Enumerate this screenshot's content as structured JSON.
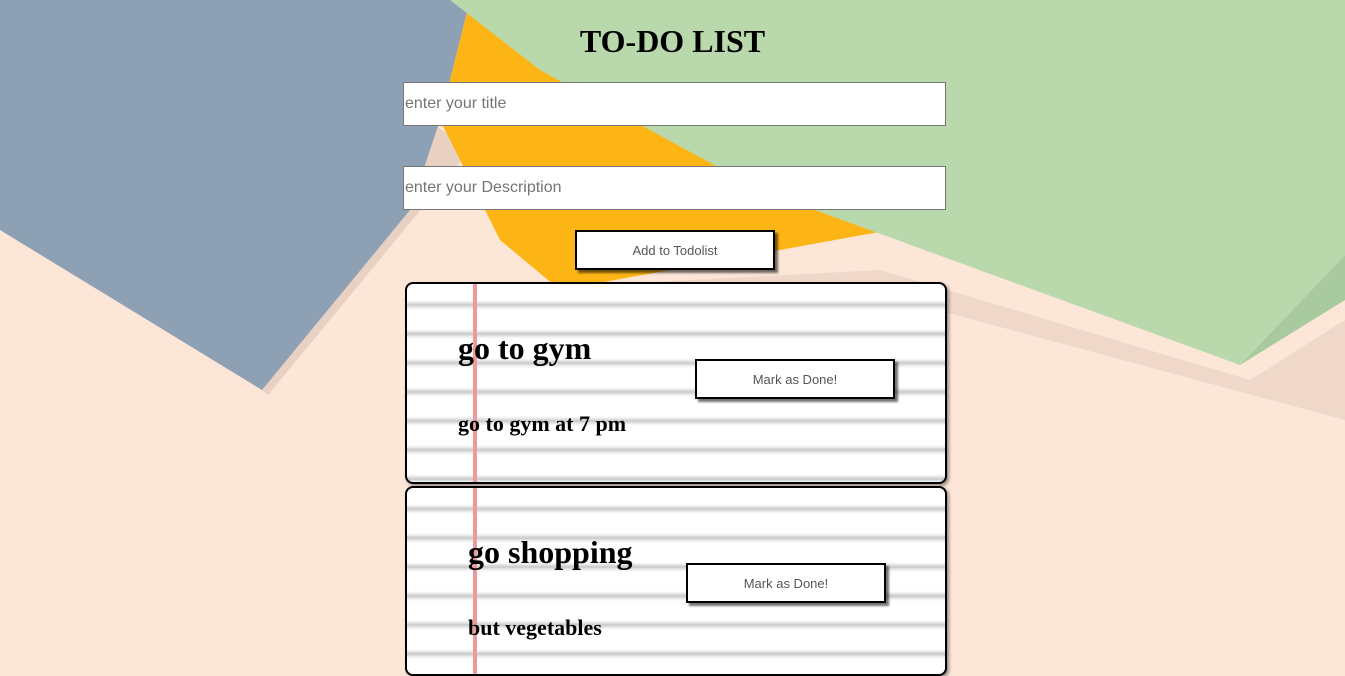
{
  "header": {
    "title": "TO-DO LIST"
  },
  "form": {
    "title_placeholder": "enter your title",
    "title_value": "",
    "description_placeholder": "enter your Description",
    "description_value": "",
    "add_button_label": "Add to Todolist"
  },
  "todos": [
    {
      "title": "go to gym",
      "description": "go to gym at 7 pm",
      "done_label": "Mark as Done!"
    },
    {
      "title": "go shopping",
      "description": "but vegetables",
      "done_label": "Mark as Done!"
    }
  ],
  "colors": {
    "background": "#fbe6d8",
    "paper_blue": "#8ea0b4",
    "paper_yellow": "#fdb515",
    "paper_green": "#b9d9ad",
    "margin_line": "#ef9a9a"
  }
}
